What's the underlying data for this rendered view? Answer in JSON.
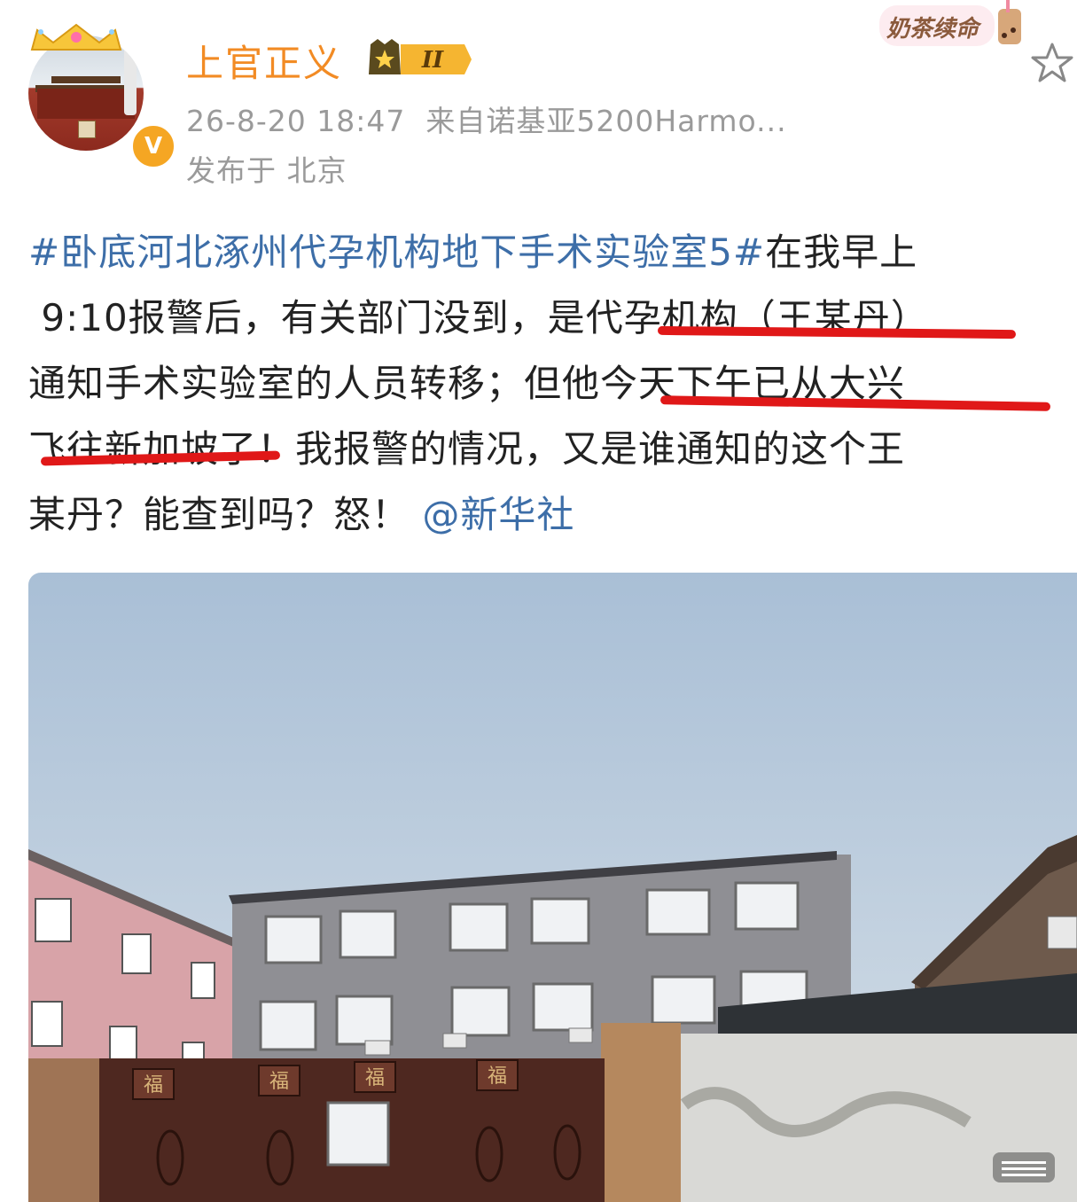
{
  "header": {
    "username": "上官正义",
    "level_badge": "II",
    "verified_badge": "V",
    "timestamp": "26-8-20 18:47",
    "source": "来自诺基亚5200Harmo...",
    "location": "发布于 北京",
    "sticker_text": "奶茶续命",
    "colors": {
      "username": "#f28b24",
      "meta": "#9a9a9a",
      "link": "#3d6ea8",
      "underline": "#e01818"
    }
  },
  "post": {
    "hashtag": "#卧底河北涿州代孕机构地下手术实验室5#",
    "line1_rest": "在我早上",
    "line2_a": "9:10报警后，有关部门没到，是",
    "line2_b": "代孕机构（王某丹）",
    "line3_a": "通知手术实验室的人员转移；但",
    "line3_b": "他今天下午已从大兴",
    "line4_a": "飞往新加坡了",
    "line4_b": "！我报警的情况，又是谁通知的这个王",
    "line5_a": "某丹？能查到吗？怒！",
    "mention": "@新华社"
  },
  "image": {
    "door_characters": [
      "福",
      "福",
      "福",
      "福"
    ]
  }
}
